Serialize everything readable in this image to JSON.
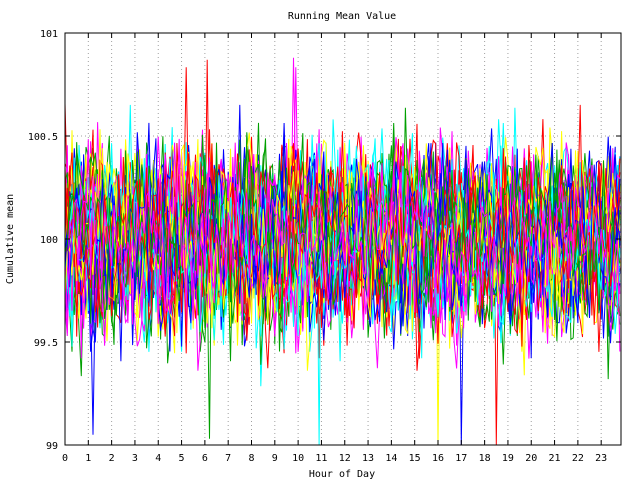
{
  "chart_data": {
    "type": "line",
    "title": "Running Mean Value",
    "xlabel": "Hour of Day",
    "ylabel": "Cumulative mean",
    "xlim": [
      0,
      23.85
    ],
    "ylim": [
      99,
      101
    ],
    "x_ticks": [
      0,
      1,
      2,
      3,
      4,
      5,
      6,
      7,
      8,
      9,
      10,
      11,
      12,
      13,
      14,
      15,
      16,
      17,
      18,
      19,
      20,
      21,
      22,
      23
    ],
    "x_tick_labels": [
      "0",
      "1",
      "2",
      "3",
      "4",
      "5",
      "6",
      "7",
      "8",
      "9",
      "10",
      "11",
      "12",
      "13",
      "14",
      "15",
      "16",
      "17",
      "18",
      "19",
      "20",
      "21",
      "22",
      "23"
    ],
    "y_ticks": [
      99,
      99.5,
      100,
      100.5,
      101
    ],
    "y_tick_labels": [
      "99",
      "99.5",
      "100",
      "100.5",
      "101"
    ],
    "grid": true,
    "legend": "none",
    "series_count": 64,
    "sample_interval_hours": 0.1,
    "mean_value": 100,
    "typical_range": [
      99.6,
      100.45
    ],
    "colors": [
      "#0000ff",
      "#ff0000",
      "#00a000",
      "#ff00ff",
      "#00ffff",
      "#ffff00"
    ],
    "notable_extremes": [
      {
        "x": 1.2,
        "y": 99.05
      },
      {
        "x": 6.1,
        "y": 100.87
      },
      {
        "x": 6.2,
        "y": 99.03
      },
      {
        "x": 9.8,
        "y": 100.88
      },
      {
        "x": 10.9,
        "y": 99.0
      },
      {
        "x": 16.0,
        "y": 99.0
      },
      {
        "x": 17.0,
        "y": 99.0
      },
      {
        "x": 18.5,
        "y": 99.0
      }
    ]
  }
}
